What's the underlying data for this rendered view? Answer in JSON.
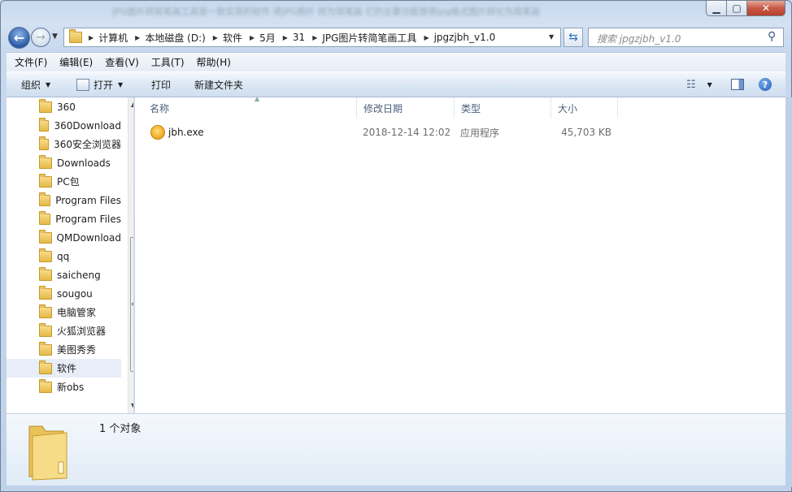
{
  "window": {
    "title": "JPG图片转简笔画工具是一款实用的软件 将JPG图片 转为简笔画 它的主要功能是将jpg格式图片转化为简笔画"
  },
  "nav": {
    "back_icon": "back-arrow-icon",
    "forward_icon": "forward-arrow-icon"
  },
  "address": {
    "crumbs": [
      "计算机",
      "本地磁盘 (D:)",
      "软件",
      "5月",
      "31",
      "JPG图片转简笔画工具",
      "jpgzjbh_v1.0"
    ]
  },
  "search": {
    "placeholder": "搜索 jpgzjbh_v1.0"
  },
  "menu": [
    "文件(F)",
    "编辑(E)",
    "查看(V)",
    "工具(T)",
    "帮助(H)"
  ],
  "toolbar": {
    "organize": "组织",
    "open": "打开",
    "print": "打印",
    "new_folder": "新建文件夹"
  },
  "tree": [
    "360",
    "360Download",
    "360安全浏览器",
    "Downloads",
    "PC包",
    "Program Files",
    "Program Files",
    "QMDownload",
    "qq",
    "saicheng",
    "sougou",
    "电脑管家",
    "火狐浏览器",
    "美图秀秀",
    "软件",
    "新obs"
  ],
  "tree_selected": "软件",
  "columns": {
    "name": "名称",
    "date": "修改日期",
    "type": "类型",
    "size": "大小"
  },
  "files": [
    {
      "name": "jbh.exe",
      "date": "2018-12-14 12:02",
      "type": "应用程序",
      "size": "45,703 KB"
    }
  ],
  "details": {
    "count_text": "1 个对象"
  },
  "colors": {
    "selection": "#e7eef8",
    "frame": "#c9d9ec",
    "close": "#c75a45"
  }
}
